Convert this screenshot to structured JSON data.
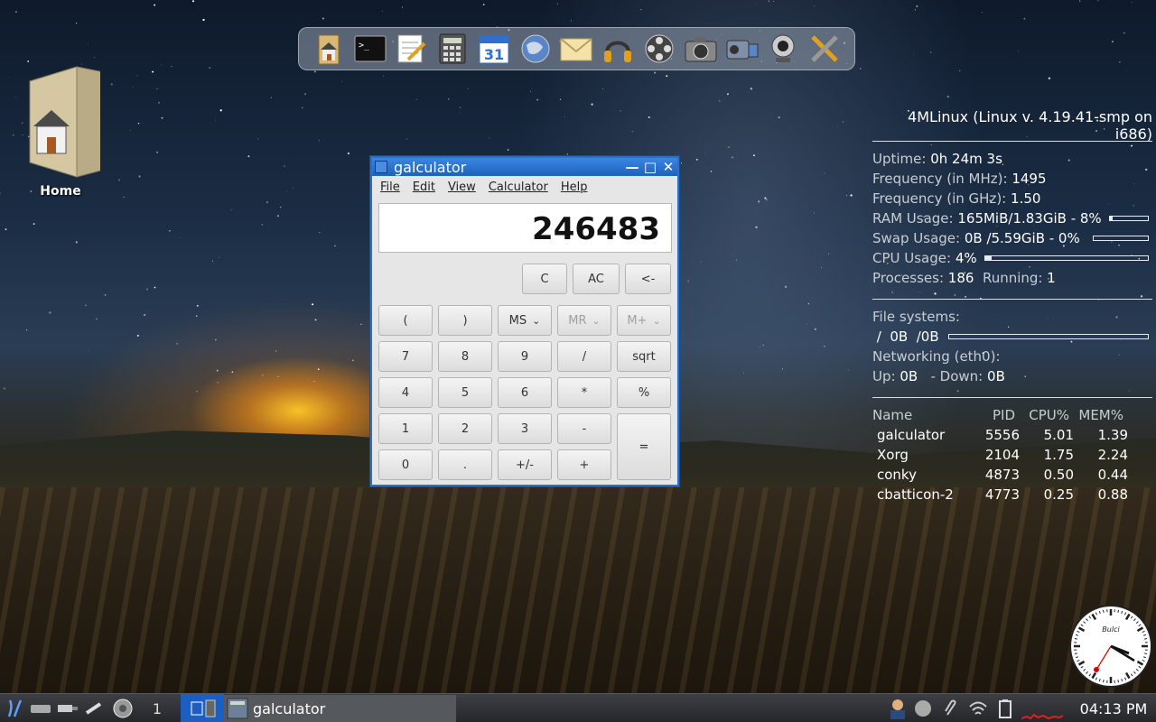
{
  "desktop": {
    "home_icon_label": "Home"
  },
  "dock": {
    "icons": [
      "home-folder-icon",
      "terminal-icon",
      "text-editor-icon",
      "calculator-icon",
      "calendar-icon",
      "web-browser-icon",
      "mail-icon",
      "headphones-icon",
      "film-reel-icon",
      "photo-camera-icon",
      "video-camera-icon",
      "webcam-icon",
      "x-tools-icon"
    ],
    "calendar_day": "31"
  },
  "conky": {
    "title": "4MLinux (Linux v. 4.19.41-smp on i686)",
    "uptime_label": "Uptime:",
    "uptime_value": "0h 24m 3s",
    "freq_mhz_label": "Frequency (in MHz):",
    "freq_mhz_value": "1495",
    "freq_ghz_label": "Frequency (in GHz):",
    "freq_ghz_value": "1.50",
    "ram_label": "RAM Usage:",
    "ram_value": "165MiB/1.83GiB - 8%",
    "ram_fraction": 0.08,
    "swap_label": "Swap Usage:",
    "swap_value": "0B  /5.59GiB - 0%",
    "swap_fraction": 0.0,
    "cpu_label": "CPU Usage:",
    "cpu_value": "4%",
    "cpu_fraction": 0.04,
    "processes_label": "Processes:",
    "processes_value": "186",
    "running_label": "Running:",
    "running_value": "1",
    "fs_label": "File systems:",
    "fs_value": " /  0B  /0B",
    "fs_fraction": 0.0,
    "net_label": "Networking (eth0):",
    "up_label": "Up:",
    "up_value": "0B",
    "down_label": " - Down:",
    "down_value": "0B",
    "proc_headers": [
      "Name",
      "PID",
      "CPU%",
      "MEM%"
    ],
    "procs": [
      [
        "galculator",
        "5556",
        "5.01",
        "1.39"
      ],
      [
        "Xorg",
        "2104",
        "1.75",
        "2.24"
      ],
      [
        "conky",
        "4873",
        "0.50",
        "0.44"
      ],
      [
        "cbatticon-2",
        "4773",
        "0.25",
        "0.88"
      ]
    ]
  },
  "calculator": {
    "title": "galculator",
    "menu": [
      "File",
      "Edit",
      "View",
      "Calculator",
      "Help"
    ],
    "display": "246483",
    "top_buttons": [
      "C",
      "AC",
      "<-"
    ],
    "memory_buttons": [
      "MS",
      "MR",
      "M+"
    ],
    "keys": {
      "open_paren": "(",
      "close_paren": ")",
      "k7": "7",
      "k8": "8",
      "k9": "9",
      "div": "/",
      "sqrt": "sqrt",
      "k4": "4",
      "k5": "5",
      "k6": "6",
      "mul": "*",
      "pct": "%",
      "k1": "1",
      "k2": "2",
      "k3": "3",
      "sub": "-",
      "eq": "=",
      "k0": "0",
      "dot": ".",
      "neg": "+/-",
      "add": "+"
    }
  },
  "taskbar": {
    "workspace": "1",
    "task_label": "galculator",
    "clock": "04:13 PM",
    "analog_clock_brand": "Bulci"
  }
}
